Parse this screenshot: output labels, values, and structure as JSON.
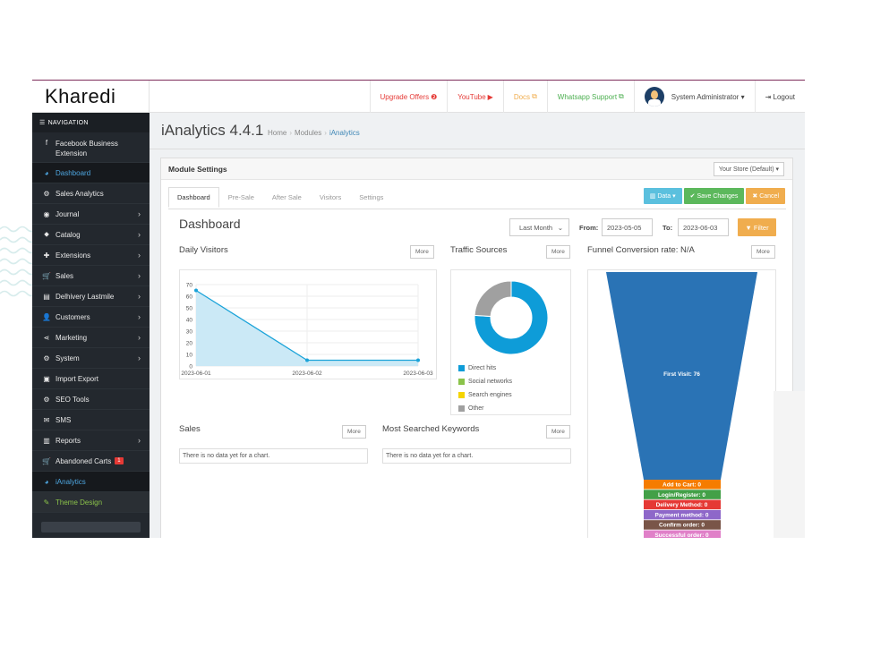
{
  "brand": {
    "logo_text": "Kharedi"
  },
  "topbar": {
    "links": [
      {
        "label": "Upgrade Offers",
        "color": "#e53935",
        "icon": "❷"
      },
      {
        "label": "YouTube",
        "color": "#e53935",
        "icon": "▶"
      },
      {
        "label": "Docs",
        "color": "#f0ad4e",
        "icon": "⧉"
      },
      {
        "label": "Whatsapp Support",
        "color": "#4caf50",
        "icon": "⧉"
      }
    ],
    "user": "System Administrator",
    "logout": "Logout"
  },
  "sidebar": {
    "header": "NAVIGATION",
    "items": [
      {
        "label": "Facebook Business Extension",
        "icon": "f"
      },
      {
        "label": "Dashboard",
        "icon": "◕"
      },
      {
        "label": "Sales Analytics",
        "icon": "⚙"
      },
      {
        "label": "Journal",
        "icon": "◉"
      },
      {
        "label": "Catalog",
        "icon": "⬥"
      },
      {
        "label": "Extensions",
        "icon": "✚"
      },
      {
        "label": "Sales",
        "icon": "🛒"
      },
      {
        "label": "Delhivery Lastmile",
        "icon": "▤"
      },
      {
        "label": "Customers",
        "icon": "👤"
      },
      {
        "label": "Marketing",
        "icon": "⋖"
      },
      {
        "label": "System",
        "icon": "⚙"
      },
      {
        "label": "Import Export",
        "icon": "▣"
      },
      {
        "label": "SEO Tools",
        "icon": "⚙"
      },
      {
        "label": "SMS",
        "icon": "✉"
      },
      {
        "label": "Reports",
        "icon": "▥"
      },
      {
        "label": "Abandoned Carts",
        "icon": "🛒",
        "badge": "1"
      },
      {
        "label": "iAnalytics",
        "icon": "◕"
      },
      {
        "label": "Theme Design",
        "icon": "✎"
      }
    ]
  },
  "page": {
    "title": "iAnalytics 4.4.1",
    "breadcrumb": [
      "Home",
      "Modules",
      "iAnalytics"
    ]
  },
  "panel": {
    "title": "Module Settings",
    "store_select": "Your Store (Default)",
    "tabs": [
      "Dashboard",
      "Pre-Sale",
      "After Sale",
      "Visitors",
      "Settings"
    ],
    "buttons": {
      "data": "Data",
      "save": "Save Changes",
      "cancel": "Cancel"
    }
  },
  "dashboard": {
    "heading": "Dashboard",
    "period": "Last Month",
    "from_label": "From:",
    "from_value": "2023-05-05",
    "to_label": "To:",
    "to_value": "2023-06-03",
    "filter_label": "Filter",
    "more_label": "More",
    "widgets": {
      "daily_visitors": "Daily Visitors",
      "traffic_sources": "Traffic Sources",
      "funnel": "Funnel Conversion rate: N/A",
      "sales": "Sales",
      "keywords": "Most Searched Keywords"
    },
    "no_data": "There is no data yet for a chart."
  },
  "chart_data": [
    {
      "type": "area",
      "title": "Daily Visitors",
      "x": [
        "2023-06-01",
        "2023-06-02",
        "2023-06-03"
      ],
      "values": [
        65,
        5,
        5
      ],
      "ylim": [
        0,
        70
      ],
      "yticks": [
        0,
        10,
        20,
        30,
        40,
        50,
        60,
        70
      ],
      "color": "#1aa3d9",
      "grid": true
    },
    {
      "type": "pie",
      "title": "Traffic Sources",
      "categories": [
        "Direct hits",
        "Social networks",
        "Search engines",
        "Other"
      ],
      "values": [
        76,
        0,
        0,
        24
      ],
      "colors": [
        "#0e9cd8",
        "#8bc34a",
        "#f5d400",
        "#a0a0a0"
      ],
      "legend": "bottom"
    },
    {
      "type": "bar",
      "title": "Funnel Conversion rate: N/A",
      "categories": [
        "First Visit",
        "Add to Cart",
        "Login/Register",
        "Delivery Method",
        "Payment method",
        "Confirm order",
        "Successful order"
      ],
      "values": [
        76,
        0,
        0,
        0,
        0,
        0,
        0
      ],
      "colors": [
        "#2a73b5",
        "#f57c00",
        "#43a047",
        "#e53935",
        "#8e67c9",
        "#795548",
        "#e080c8"
      ]
    }
  ]
}
